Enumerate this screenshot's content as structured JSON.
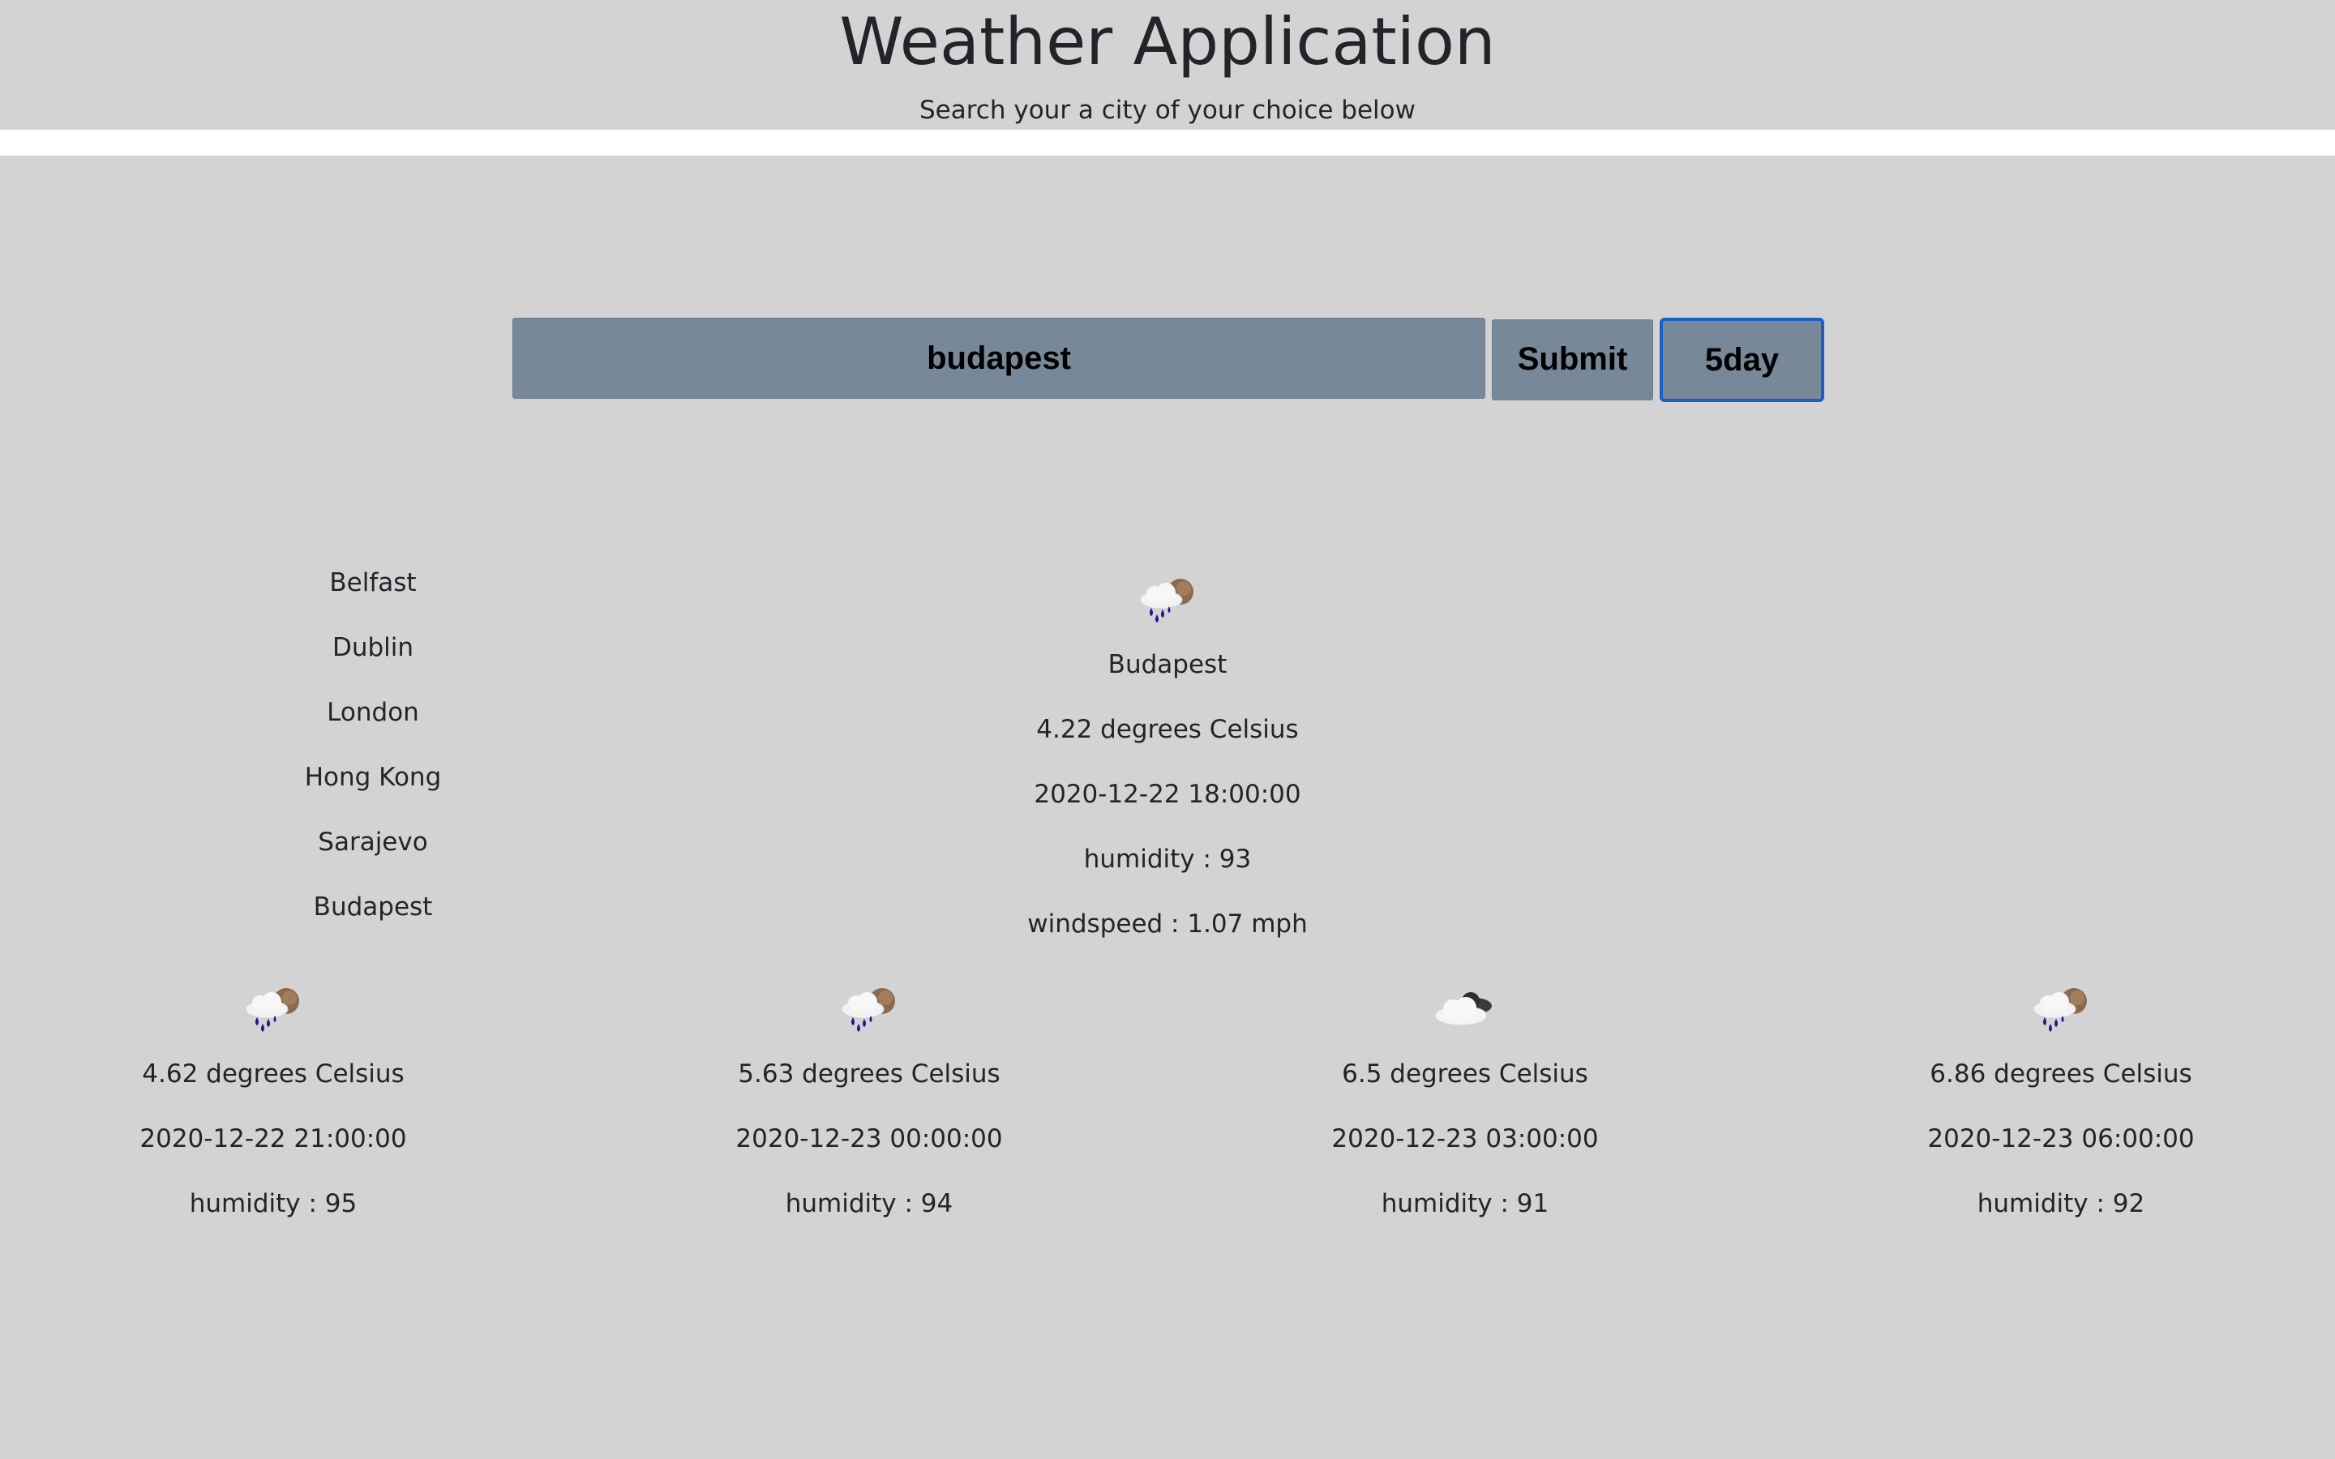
{
  "header": {
    "title": "Weather Application",
    "subtitle": "Search your a city of your choice below"
  },
  "search": {
    "value": "budapest",
    "submit_label": "Submit",
    "fiveday_label": "5day"
  },
  "cities": [
    "Belfast",
    "Dublin",
    "London",
    "Hong Kong",
    "Sarajevo",
    "Budapest"
  ],
  "current": {
    "icon": "rain-sun-icon",
    "city": "Budapest",
    "temperature": "4.22 degrees Celsius",
    "datetime": "2020-12-22 18:00:00",
    "humidity": "humidity : 93",
    "windspeed": "windspeed : 1.07 mph"
  },
  "forecast": [
    {
      "icon": "rain-sun-icon",
      "temperature": "4.62 degrees Celsius",
      "datetime": "2020-12-22 21:00:00",
      "humidity": "humidity : 95"
    },
    {
      "icon": "rain-sun-icon",
      "temperature": "5.63 degrees Celsius",
      "datetime": "2020-12-23 00:00:00",
      "humidity": "humidity : 94"
    },
    {
      "icon": "cloud-icon",
      "temperature": "6.5 degrees Celsius",
      "datetime": "2020-12-23 03:00:00",
      "humidity": "humidity : 91"
    },
    {
      "icon": "rain-sun-icon",
      "temperature": "6.86 degrees Celsius",
      "datetime": "2020-12-23 06:00:00",
      "humidity": "humidity : 92"
    }
  ],
  "colors": {
    "background": "#d3d3d3",
    "divider": "#ffffff",
    "control": "#778899",
    "focus_border": "#1a5fc4",
    "text": "#212529"
  }
}
